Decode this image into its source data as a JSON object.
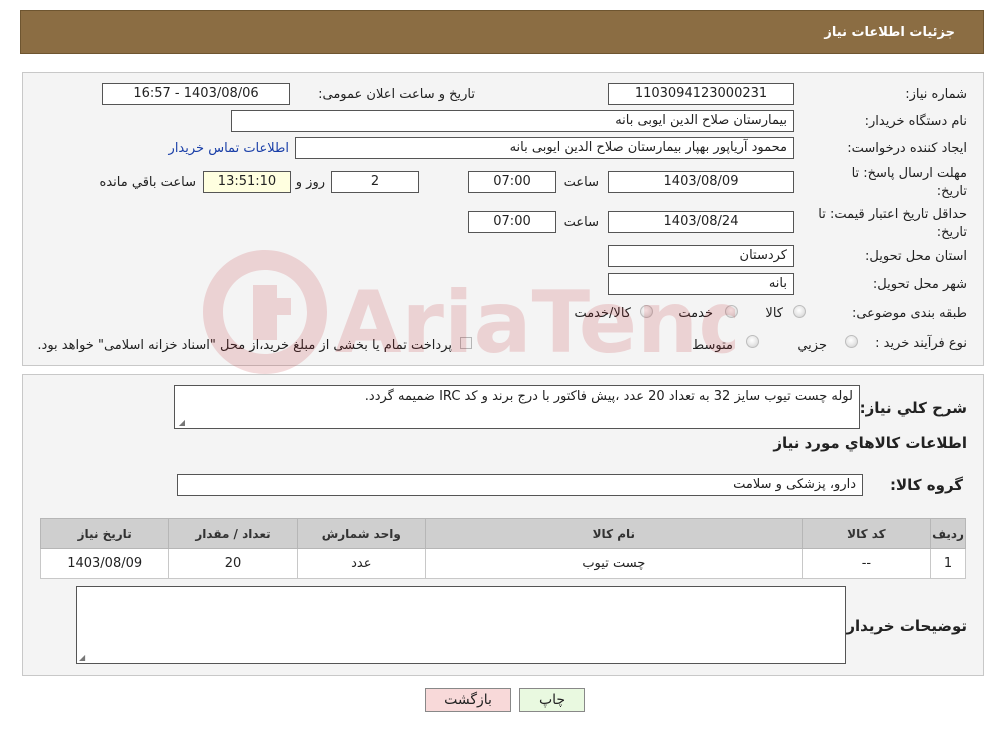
{
  "header": {
    "title": "جزئیات اطلاعات نیاز"
  },
  "details": {
    "need_number_label": "شماره نیاز:",
    "need_number": "1103094123000231",
    "announce_label": "تاریخ و ساعت اعلان عمومی:",
    "announce_value": "1403/08/06 - 16:57",
    "buyer_org_label": "نام دستگاه خریدار:",
    "buyer_org": "بیمارستان صلاح الدین ایوبی بانه",
    "creator_label": "ایجاد کننده درخواست:",
    "creator": "محمود آریاپور بهپار بیمارستان صلاح الدین ایوبی بانه",
    "contact_link": "اطلاعات تماس خریدار",
    "reply_deadline_label_1": "مهلت ارسال پاسخ: تا",
    "reply_deadline_label_2": "تاریخ:",
    "reply_date": "1403/08/09",
    "time_label": "ساعت",
    "reply_time": "07:00",
    "days_value": "2",
    "days_label": "روز و",
    "remaining_time": "13:51:10",
    "remaining_label": "ساعت باقي مانده",
    "price_validity_label_1": "حداقل تاریخ اعتبار قیمت: تا",
    "price_validity_label_2": "تاریخ:",
    "price_validity_date": "1403/08/24",
    "price_validity_time": "07:00",
    "province_label": "استان محل تحویل:",
    "province": "کردستان",
    "city_label": "شهر محل تحویل:",
    "city": "بانه",
    "category_label": "طبقه بندی موضوعی:",
    "category_options": [
      "کالا",
      "خدمت",
      "کالا/خدمت"
    ],
    "purchase_type_label": "نوع فرآیند خرید :",
    "purchase_options": [
      "جزيي",
      "متوسط"
    ],
    "purchase_note": "پرداخت تمام یا بخشی از مبلغ خرید،از محل \"اسناد خزانه اسلامی\" خواهد بود."
  },
  "description": {
    "label": "شرح کلي نياز:",
    "text": "لوله چست تیوب سایز 32 به تعداد 20 عدد ،پیش فاکتور با درج برند و کد IRC ضمیمه گردد."
  },
  "goods": {
    "section_title": "اطلاعات کالاهاي مورد نياز",
    "group_label": "گروه کالا:",
    "group_value": "دارو، پزشکی و سلامت",
    "columns": [
      "رديف",
      "کد کالا",
      "نام کالا",
      "واحد شمارش",
      "تعداد / مقدار",
      "تاريخ نياز"
    ],
    "rows": [
      {
        "row": "1",
        "code": "--",
        "name": "چست تیوب",
        "unit": "عدد",
        "qty": "20",
        "date": "1403/08/09"
      }
    ]
  },
  "buyer_notes": {
    "label": "توضیحات خریدار:"
  },
  "buttons": {
    "print": "چاپ",
    "back": "بازگشت"
  },
  "watermark": {
    "text": "AriaTender.neT"
  },
  "colors": {
    "header_bg": "#8b6d43",
    "link": "#1a3fa8",
    "back_btn": "#f8d9d9",
    "print_btn": "#e9f9e0"
  }
}
